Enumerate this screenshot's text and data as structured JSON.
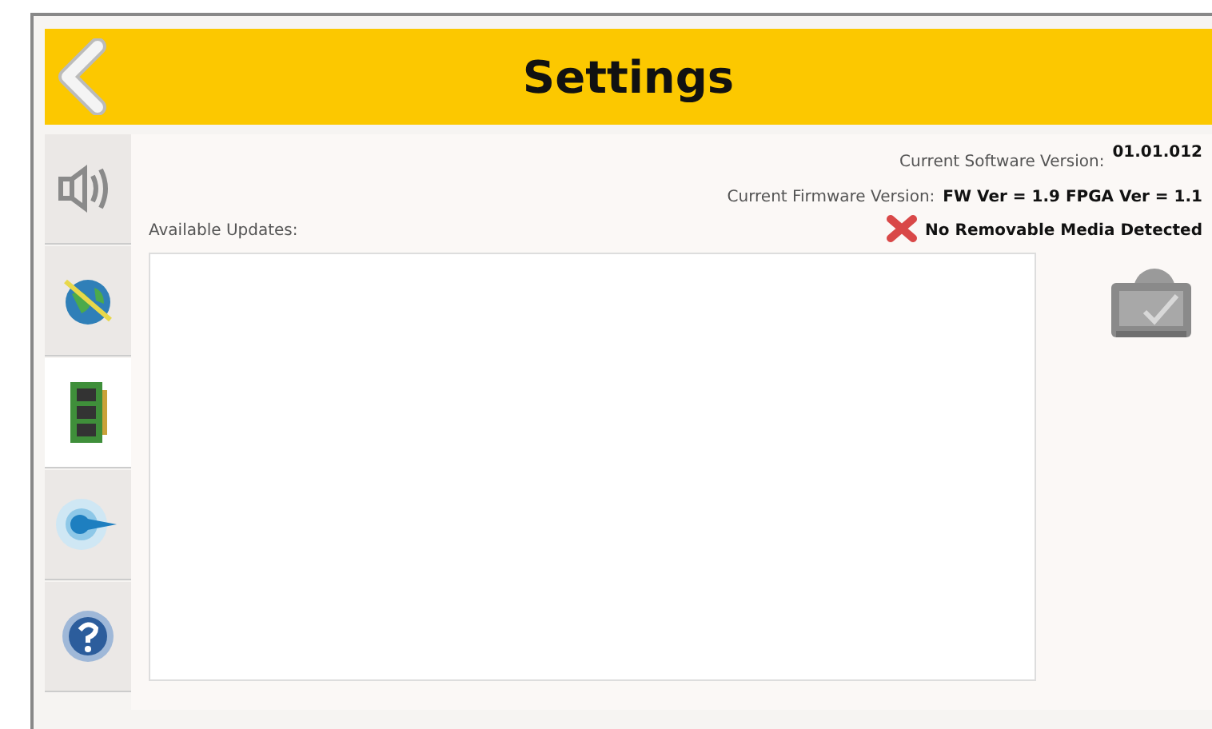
{
  "header": {
    "title": "Settings"
  },
  "sidebar": {
    "tabs": [
      {
        "kind": "speaker",
        "selected": false
      },
      {
        "kind": "globe",
        "selected": false
      },
      {
        "kind": "memory",
        "selected": true
      },
      {
        "kind": "signal",
        "selected": false
      },
      {
        "kind": "help",
        "selected": false
      }
    ]
  },
  "info": {
    "software_label": "Current Software Version:",
    "software_value": "01.01.012",
    "firmware_label": "Current Firmware Version:",
    "firmware_value": "FW Ver = 1.9 FPGA Ver = 1.1",
    "media_status": "No Removable Media Detected",
    "media_detected": false
  },
  "updates": {
    "label": "Available Updates:"
  }
}
